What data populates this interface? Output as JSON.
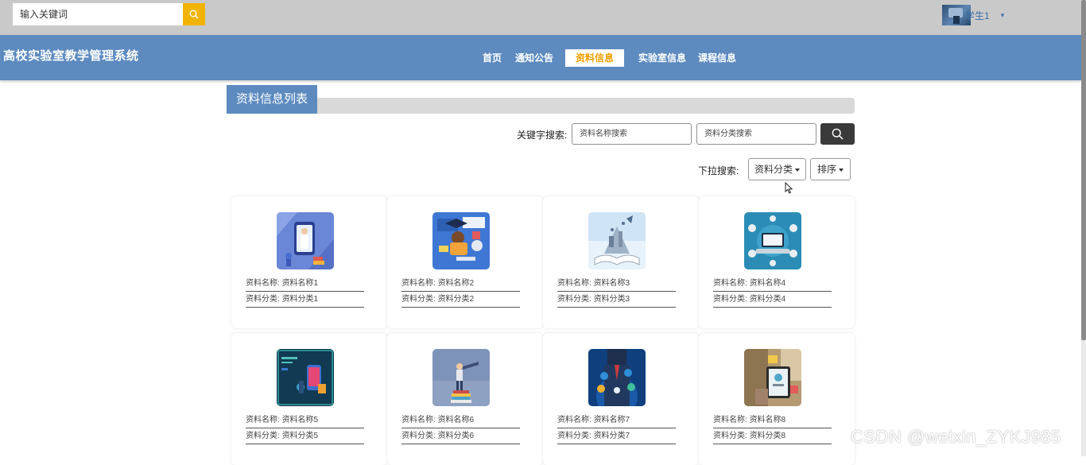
{
  "topbar": {
    "search_placeholder": "输入关键词",
    "search_icon": "search-icon",
    "search_button_color": "#f0b400",
    "user_name": "学生1",
    "user_menu_icon": "caret-down-icon"
  },
  "nav": {
    "brand": "高校实验室教学管理系统",
    "background": "#5d8bc0",
    "items": [
      {
        "label": "首页",
        "active": false
      },
      {
        "label": "通知公告",
        "active": false
      },
      {
        "label": "资料信息",
        "active": true
      },
      {
        "label": "实验室信息",
        "active": false
      },
      {
        "label": "课程信息",
        "active": false
      }
    ],
    "active_color": "#f0a000"
  },
  "section": {
    "title": "资料信息列表"
  },
  "search": {
    "keyword_label": "关键字搜索:",
    "name_placeholder": "资料名称搜索",
    "category_placeholder": "资料分类搜索",
    "search_icon": "search-icon",
    "dropdown_label": "下拉搜索:",
    "category_dropdown": "资料分类",
    "sort_dropdown": "排序"
  },
  "cards": [
    {
      "name_label": "资料名称:",
      "name": "资料名称1",
      "cat_label": "资料分类:",
      "category": "资料分类1"
    },
    {
      "name_label": "资料名称:",
      "name": "资料名称2",
      "cat_label": "资料分类:",
      "category": "资料分类2"
    },
    {
      "name_label": "资料名称:",
      "name": "资料名称3",
      "cat_label": "资料分类:",
      "category": "资料分类3"
    },
    {
      "name_label": "资料名称:",
      "name": "资料名称4",
      "cat_label": "资料分类:",
      "category": "资料分类4"
    },
    {
      "name_label": "资料名称:",
      "name": "资料名称5",
      "cat_label": "资料分类:",
      "category": "资料分类5"
    },
    {
      "name_label": "资料名称:",
      "name": "资料名称6",
      "cat_label": "资料分类:",
      "category": "资料分类6"
    },
    {
      "name_label": "资料名称:",
      "name": "资料名称7",
      "cat_label": "资料分类:",
      "category": "资料分类7"
    },
    {
      "name_label": "资料名称:",
      "name": "资料名称8",
      "cat_label": "资料分类:",
      "category": "资料分类8"
    }
  ],
  "watermark": "CSDN @weixin_ZYKJ985"
}
